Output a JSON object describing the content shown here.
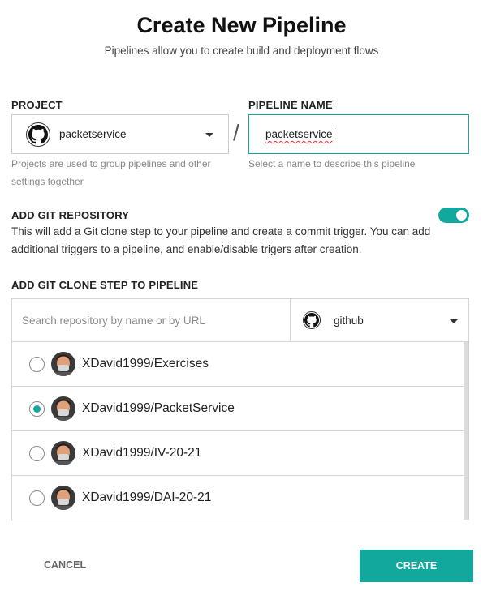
{
  "header": {
    "title": "Create New Pipeline",
    "subtitle": "Pipelines allow you to create build and deployment flows"
  },
  "project": {
    "label": "PROJECT",
    "value": "packetservice",
    "icon": "github-icon",
    "helper": "Projects are used to group pipelines and other settings together"
  },
  "separator": "/",
  "pipeline_name": {
    "label": "PIPELINE NAME",
    "value": "packetservice",
    "helper": "Select a name to describe this pipeline"
  },
  "git_repo": {
    "label": "ADD GIT REPOSITORY",
    "enabled": true,
    "description": "This will add a Git clone step to your pipeline and create a commit trigger. You can add additional triggers to a pipeline, and enable/disable trigers after creation."
  },
  "clone_step": {
    "label": "ADD GIT CLONE STEP TO PIPELINE",
    "search_placeholder": "Search repository by name or by URL",
    "provider": "github",
    "repos": [
      {
        "name": "XDavid1999/Exercises",
        "selected": false
      },
      {
        "name": "XDavid1999/PacketService",
        "selected": true
      },
      {
        "name": "XDavid1999/IV-20-21",
        "selected": false
      },
      {
        "name": "XDavid1999/DAI-20-21",
        "selected": false
      }
    ]
  },
  "footer": {
    "cancel_label": "CANCEL",
    "create_label": "CREATE"
  },
  "colors": {
    "accent": "#13a89e"
  }
}
